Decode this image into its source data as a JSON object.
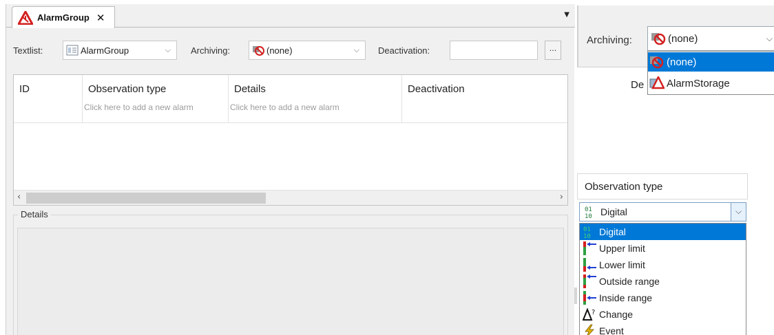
{
  "editor": {
    "tab_title": "AlarmGroup",
    "tab_close": "✕",
    "tab_menu": "▼",
    "textlist_label": "Textlist:",
    "textlist_value": "AlarmGroup",
    "archiving_label": "Archiving:",
    "archiving_value": "(none)",
    "deactivation_label": "Deactivation:",
    "deactivation_value": "",
    "ellipsis": "...",
    "columns": [
      {
        "header": "ID",
        "hint": ""
      },
      {
        "header": "Observation type",
        "hint": "Click here to add a new alarm"
      },
      {
        "header": "Details",
        "hint": "Click here to add a new alarm"
      },
      {
        "header": "Deactivation",
        "hint": ""
      }
    ],
    "details_label": "Details"
  },
  "archiving_dropdown": {
    "label": "Archiving:",
    "value": "(none)",
    "options": [
      "(none)",
      "AlarmStorage"
    ],
    "selected_index": 0,
    "behind_text": "De"
  },
  "observation_dropdown": {
    "header": "Observation type",
    "value": "Digital",
    "options": [
      "Digital",
      "Upper limit",
      "Lower limit",
      "Outside range",
      "Inside range",
      "Change",
      "Event"
    ],
    "selected_index": 0
  },
  "icons": {
    "tab": "alarm-warning-icon",
    "textlist": "textlist-icon",
    "archiving": "archive-forbidden-icon",
    "digital": "digital-bits-icon",
    "change": "delta-question-icon",
    "event": "lightning-icon"
  },
  "colors": {
    "selection": "#0078d7",
    "alarm_red": "#d32020"
  }
}
